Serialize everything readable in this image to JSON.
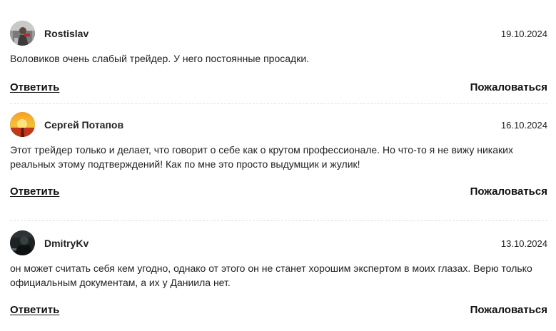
{
  "comments": [
    {
      "author": "Rostislav",
      "date": "19.10.2024",
      "text": "Воловиков очень слабый трейдер. У него постоянные просадки.",
      "avatar_icon": "user-photo-icon",
      "reply_label": "Ответить",
      "report_label": "Пожаловаться"
    },
    {
      "author": "Сергей Потапов",
      "date": "16.10.2024",
      "text": "Этот трейдер только и делает, что говорит о себе как о крутом профессионале. Но что-то я не вижу никаких реальных этому подтверждений! Как по мне это просто выдумщик и жулик!",
      "avatar_icon": "sunset-photo-icon",
      "reply_label": "Ответить",
      "report_label": "Пожаловаться"
    },
    {
      "author": "DmitryKv",
      "date": "13.10.2024",
      "text": "он может считать себя кем угодно, однако от этого он не станет хорошим экспертом в моих глазах. Верю только официальным документам, а их у Даниила нет.",
      "avatar_icon": "dark-photo-icon",
      "reply_label": "Ответить",
      "report_label": "Пожаловаться"
    }
  ]
}
